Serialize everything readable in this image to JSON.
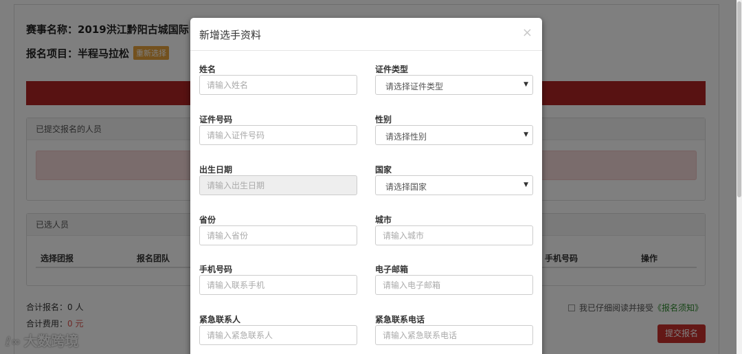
{
  "page": {
    "event_title": "赛事名称：2019洪江黔阳古城国际",
    "project_prefix": "报名项目：半程马拉松",
    "reselect_label": "重新选择",
    "submitted_panel_title": "已提交报名的人员",
    "selected_panel_title": "已选人员",
    "table_headers": [
      "选择团报",
      "报名团队",
      "手机号码",
      "操作"
    ],
    "total_count_label": "合计报名：0 人",
    "total_fee_prefix": "合计费用：",
    "total_fee_value": "0 元",
    "agree_text": "我已仔细阅读并接受",
    "agree_link": "《报名须知》",
    "submit_label": "提交报名",
    "watermark": "大数跨境"
  },
  "modal": {
    "title": "新增选手资料",
    "close_glyph": "×",
    "fields": {
      "name": {
        "label": "姓名",
        "placeholder": "请输入姓名"
      },
      "id_type": {
        "label": "证件类型",
        "selected": "请选择证件类型"
      },
      "id_number": {
        "label": "证件号码",
        "placeholder": "请输入证件号码"
      },
      "gender": {
        "label": "性别",
        "selected": "请选择性别"
      },
      "birth_date": {
        "label": "出生日期",
        "placeholder": "请输入出生日期"
      },
      "country": {
        "label": "国家",
        "selected": "请选择国家"
      },
      "province": {
        "label": "省份",
        "placeholder": "请输入省份"
      },
      "city": {
        "label": "城市",
        "placeholder": "请输入城市"
      },
      "phone": {
        "label": "手机号码",
        "placeholder": "请输入联系手机"
      },
      "email": {
        "label": "电子邮箱",
        "placeholder": "请输入电子邮箱"
      },
      "emergency_contact": {
        "label": "紧急联系人",
        "placeholder": "请输入紧急联系人"
      },
      "emergency_phone": {
        "label": "紧急联系电话",
        "placeholder": "请输入紧急联系电话"
      }
    }
  },
  "colors": {
    "accent_red": "#b12424",
    "submit_red": "#c9302c",
    "badge_orange": "#e6a23c",
    "notice_green": "#2d8a2d"
  }
}
